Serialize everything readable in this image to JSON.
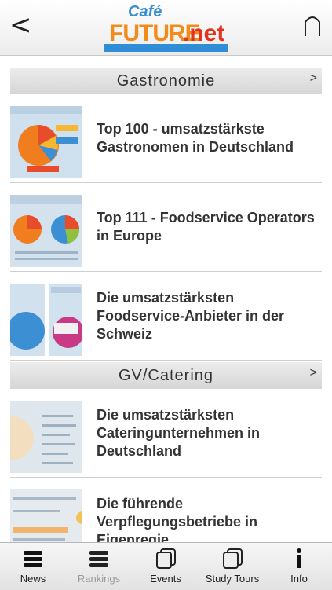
{
  "header": {
    "logo": {
      "cafe": "Café",
      "future": "FUTURE",
      "net": ".net"
    }
  },
  "sections": [
    {
      "title": "Gastronomie",
      "items": [
        {
          "title": "Top 100 - umsatzstärkste Gastronomen in Deutschland"
        },
        {
          "title": "Top 111 - Foodservice Operators in Europe"
        },
        {
          "title": "Die umsatzstärksten Foodservice-Anbieter in der Schweiz"
        }
      ]
    },
    {
      "title": "GV/Catering",
      "items": [
        {
          "title": "Die umsatzstärksten Cateringunternehmen in Deutschland"
        },
        {
          "title": "Die führende Verpflegungsbetriebe in Eigenregie"
        }
      ]
    }
  ],
  "tabs": [
    {
      "label": "News",
      "icon": "list-icon",
      "active": true
    },
    {
      "label": "Rankings",
      "icon": "list-icon",
      "active": false
    },
    {
      "label": "Events",
      "icon": "stack-icon",
      "active": true
    },
    {
      "label": "Study Tours",
      "icon": "stack-icon",
      "active": true
    },
    {
      "label": "Info",
      "icon": "info-icon",
      "active": true
    }
  ]
}
